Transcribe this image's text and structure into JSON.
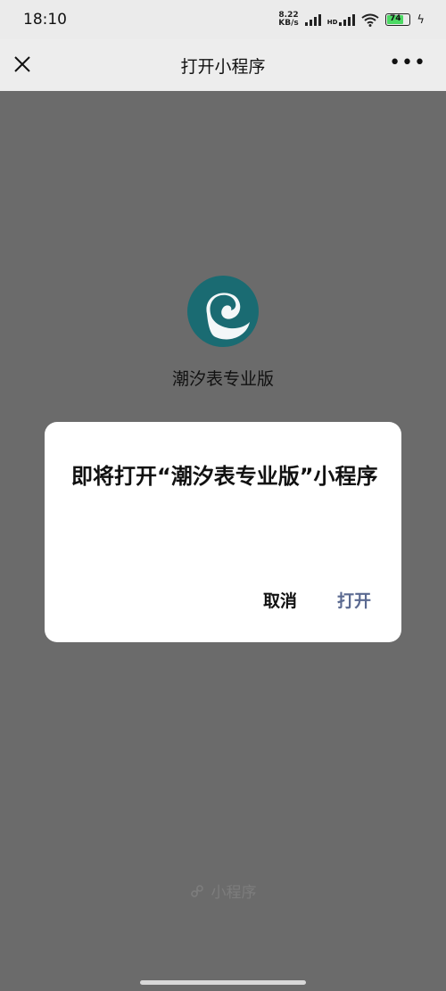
{
  "status": {
    "time": "18:10",
    "speed_value": "8.22",
    "speed_unit": "KB/s",
    "hd1": "HD",
    "battery": "74"
  },
  "nav": {
    "title": "打开小程序",
    "close_icon": "close-icon",
    "more_icon": "more-icon"
  },
  "app": {
    "name": "潮汐表专业版",
    "logo_icon": "wave-logo",
    "logo_color": "#1a6b72"
  },
  "dialog": {
    "message": "即将打开“潮汐表专业版”小程序",
    "cancel_label": "取消",
    "open_label": "打开",
    "open_color": "#5b6a91"
  },
  "footer": {
    "icon": "mini-program-icon",
    "label": "小程序"
  }
}
